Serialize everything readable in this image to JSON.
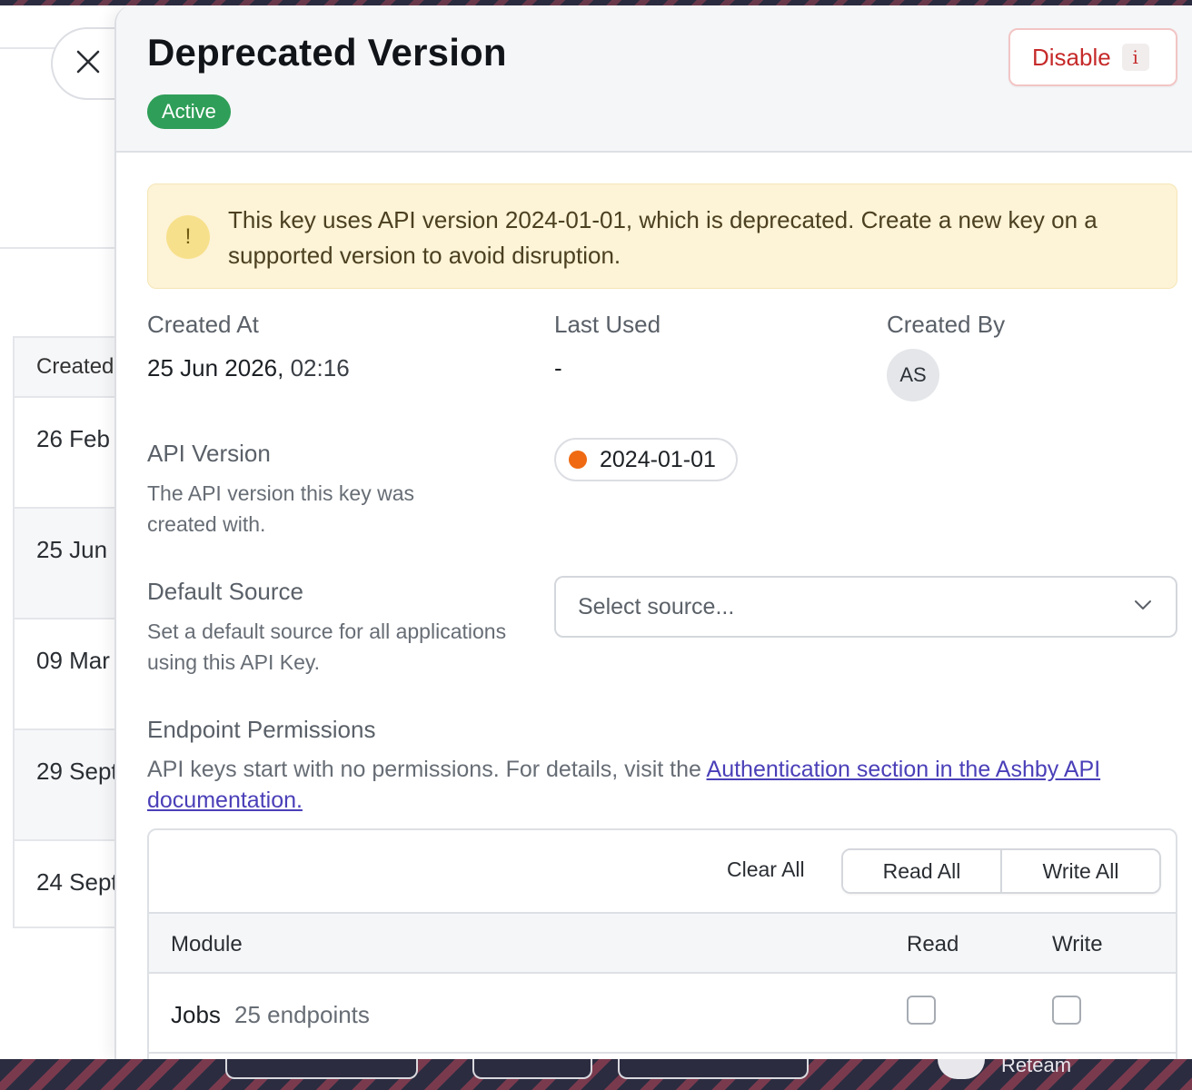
{
  "background_list": {
    "column_header": "Created",
    "rows": [
      "26 Feb",
      "25 Jun",
      "09 Mar",
      "29 Sept",
      "24 Sept"
    ]
  },
  "panel": {
    "title": "Deprecated Version",
    "status": "Active",
    "disable_label": "Disable",
    "disable_shortcut": "i",
    "warning_icon": "!",
    "warning": "This key uses API version 2024-01-01, which is deprecated. Create a new key on a supported version to avoid disruption.",
    "created_at": {
      "label": "Created At",
      "date": "25 Jun 2026,",
      "time": "02:16"
    },
    "last_used": {
      "label": "Last Used",
      "value": "-"
    },
    "created_by": {
      "label": "Created By",
      "initials": "AS"
    },
    "api_version": {
      "label": "API Version",
      "description": "The API version this key was created with.",
      "value": "2024-01-01",
      "status_color": "#ef6a12"
    },
    "default_source": {
      "label": "Default Source",
      "description": "Set a default source for all applications using this API Key.",
      "placeholder": "Select source..."
    },
    "endpoint_permissions": {
      "label": "Endpoint Permissions",
      "description_prefix": "API keys start with no permissions. For details, visit the ",
      "link_text": "Authentication section in the Ashby API documentation.",
      "clear_all": "Clear All",
      "read_all": "Read All",
      "write_all": "Write All",
      "columns": {
        "module": "Module",
        "read": "Read",
        "write": "Write"
      },
      "rows": [
        {
          "module": "Jobs",
          "endpoints": "25 endpoints",
          "read": false,
          "write": false
        }
      ]
    }
  },
  "bottom_bar": {
    "label": "Reteam"
  },
  "colors": {
    "accent_green": "#2f9e58",
    "danger": "#c62a2a",
    "link": "#4a3fb8",
    "warning_bg": "#fdf3d6"
  }
}
